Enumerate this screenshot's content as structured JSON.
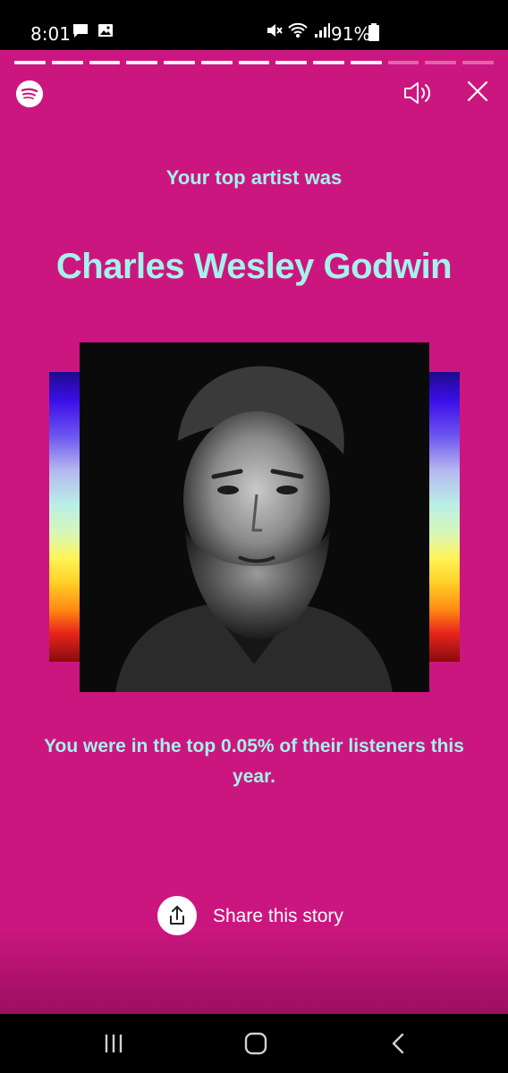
{
  "status_bar": {
    "time": "8:01",
    "battery_percent": "91%",
    "icons": [
      "chat-bubble-icon",
      "image-icon",
      "mute-icon",
      "wifi-icon",
      "signal-icon",
      "battery-icon"
    ]
  },
  "story": {
    "progress": {
      "total_segments": 13,
      "completed_segments": 10
    },
    "lead_text": "Your top artist was",
    "artist_name": "Charles Wesley Godwin",
    "stat_text": "You were in the top 0.05% of their listeners this year.",
    "share_label": "Share this story",
    "icons": [
      "spotify-logo-icon",
      "speaker-icon",
      "close-icon",
      "share-icon"
    ]
  },
  "colors": {
    "background": "#cc167f",
    "accent_text": "#a5f2ea"
  },
  "nav_bar": {
    "icons": [
      "recent-apps-icon",
      "home-icon",
      "back-icon"
    ]
  }
}
